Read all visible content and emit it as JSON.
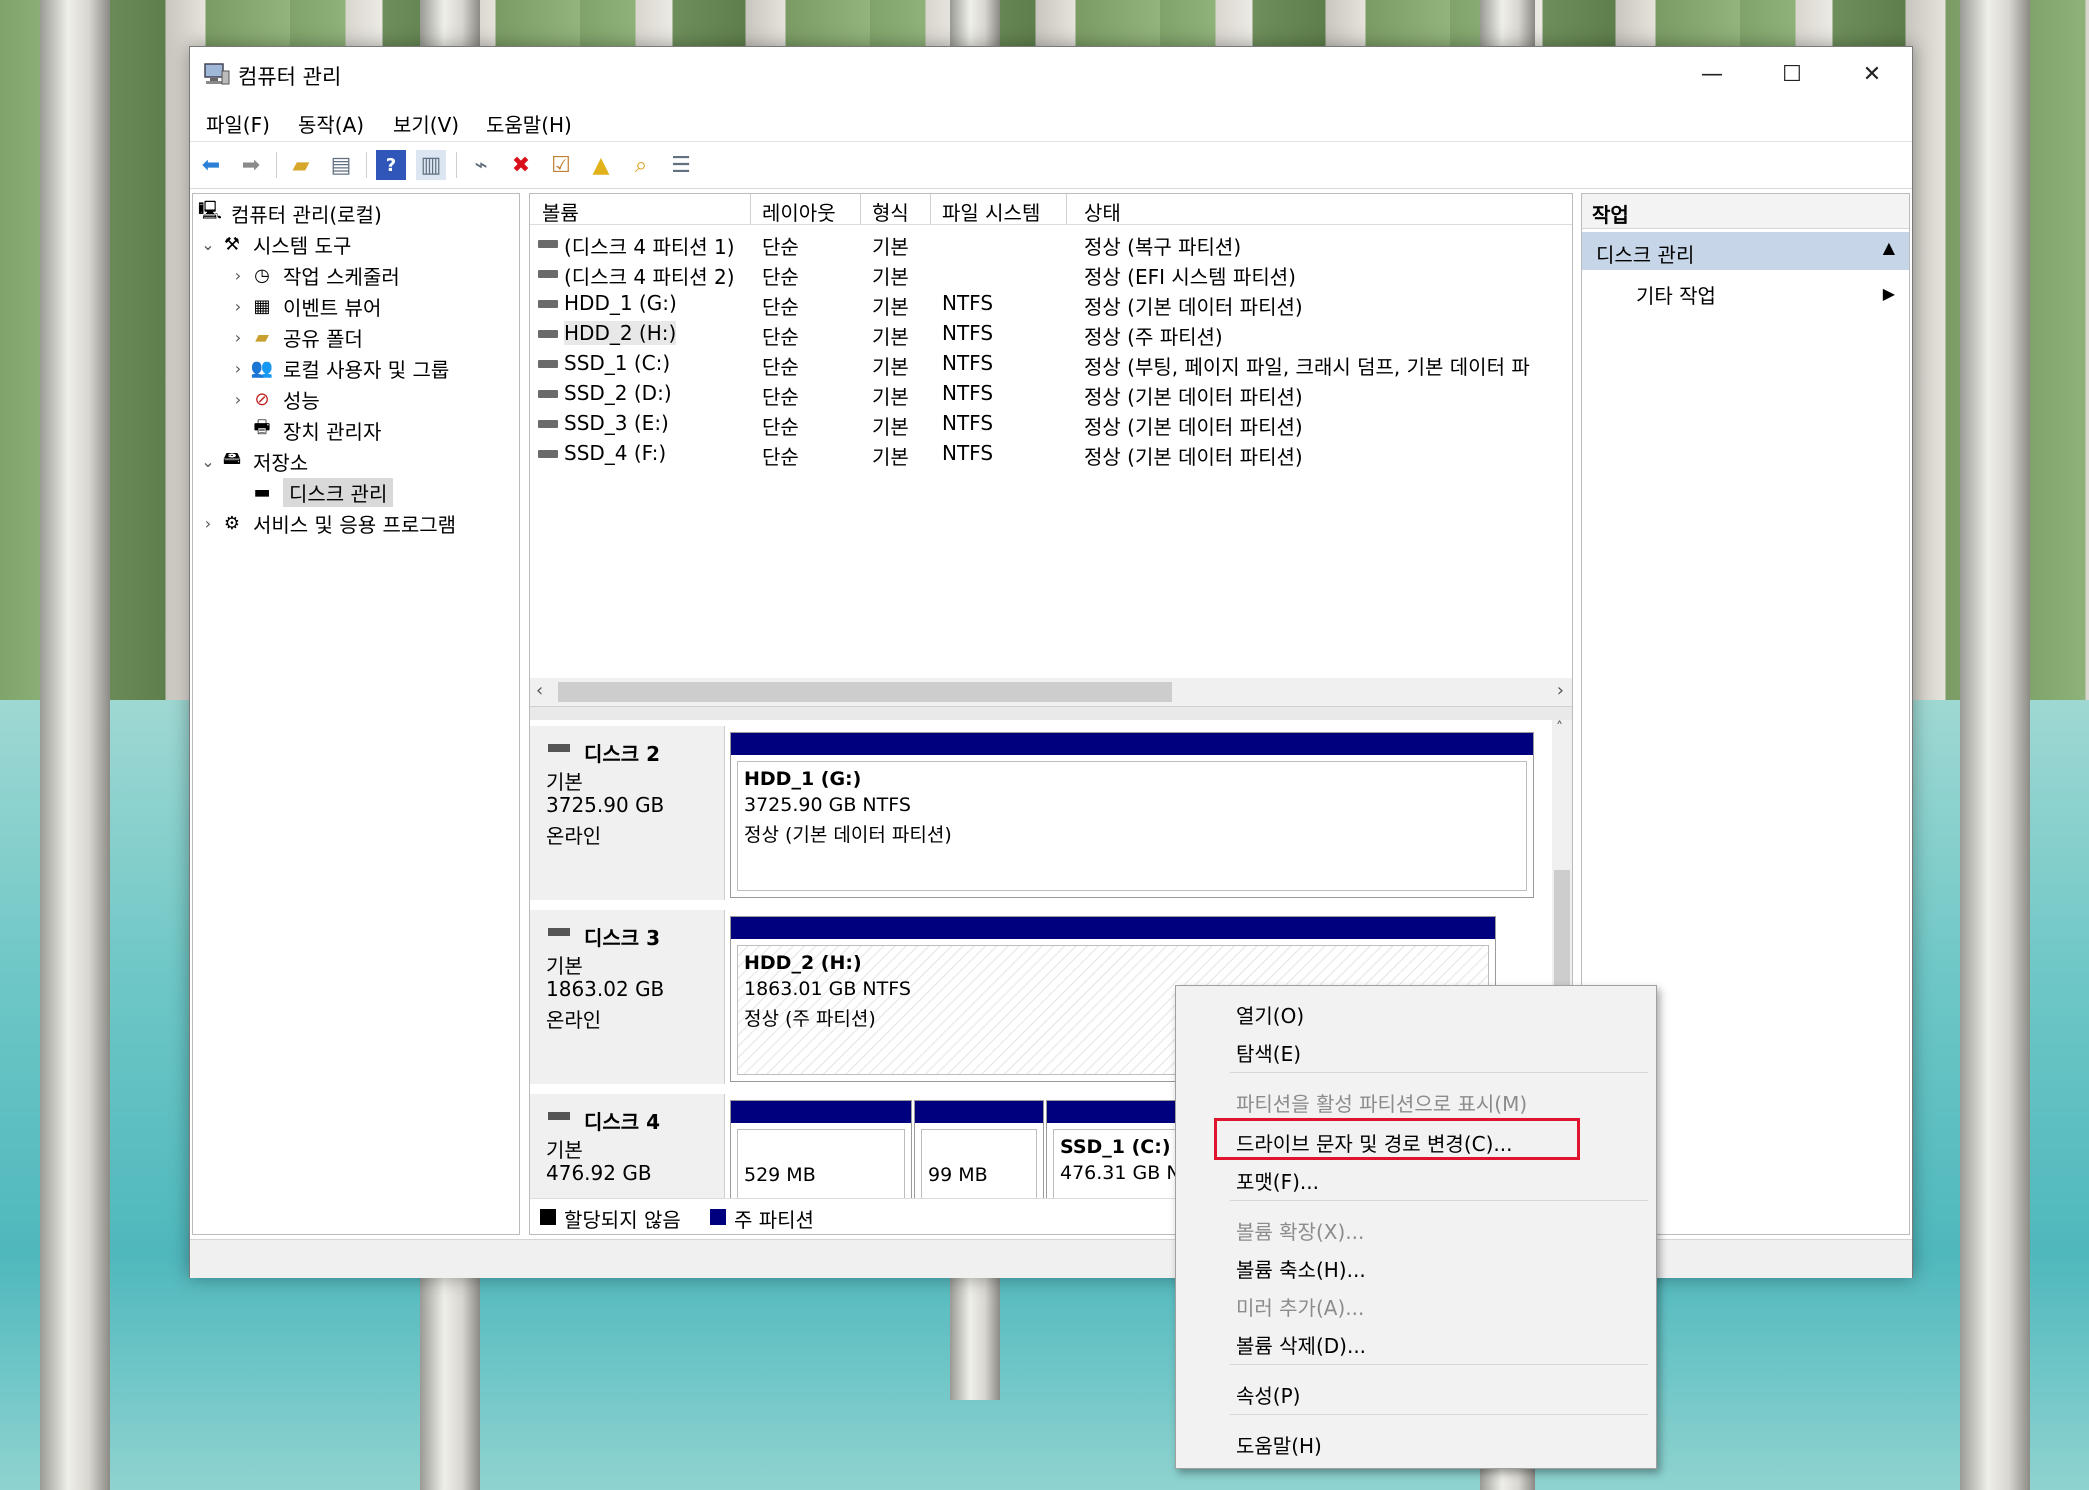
{
  "window": {
    "title": "컴퓨터 관리",
    "minimize": "—",
    "maximize": "☐",
    "close": "✕"
  },
  "menu": {
    "file": "파일(F)",
    "action": "동작(A)",
    "view": "보기(V)",
    "help": "도움말(H)"
  },
  "tree": {
    "root": "컴퓨터 관리(로컬)",
    "system_tools": "시스템 도구",
    "task_scheduler": "작업 스케줄러",
    "event_viewer": "이벤트 뷰어",
    "shared_folders": "공유 폴더",
    "local_users": "로컬 사용자 및 그룹",
    "performance": "성능",
    "device_manager": "장치 관리자",
    "storage": "저장소",
    "disk_management": "디스크 관리",
    "services_apps": "서비스 및 응용 프로그램"
  },
  "volumes": {
    "headers": {
      "volume": "볼륨",
      "layout": "레이아웃",
      "type": "형식",
      "fs": "파일 시스템",
      "status": "상태"
    },
    "rows": [
      {
        "name": "(디스크 4 파티션 1)",
        "layout": "단순",
        "type": "기본",
        "fs": "",
        "status": "정상 (복구 파티션)"
      },
      {
        "name": "(디스크 4 파티션 2)",
        "layout": "단순",
        "type": "기본",
        "fs": "",
        "status": "정상 (EFI 시스템 파티션)"
      },
      {
        "name": "HDD_1 (G:)",
        "layout": "단순",
        "type": "기본",
        "fs": "NTFS",
        "status": "정상 (기본 데이터 파티션)"
      },
      {
        "name": "HDD_2 (H:)",
        "layout": "단순",
        "type": "기본",
        "fs": "NTFS",
        "status": "정상 (주 파티션)"
      },
      {
        "name": "SSD_1 (C:)",
        "layout": "단순",
        "type": "기본",
        "fs": "NTFS",
        "status": "정상 (부팅, 페이지 파일, 크래시 덤프, 기본 데이터 파"
      },
      {
        "name": "SSD_2 (D:)",
        "layout": "단순",
        "type": "기본",
        "fs": "NTFS",
        "status": "정상 (기본 데이터 파티션)"
      },
      {
        "name": "SSD_3 (E:)",
        "layout": "단순",
        "type": "기본",
        "fs": "NTFS",
        "status": "정상 (기본 데이터 파티션)"
      },
      {
        "name": "SSD_4 (F:)",
        "layout": "단순",
        "type": "기본",
        "fs": "NTFS",
        "status": "정상 (기본 데이터 파티션)"
      }
    ]
  },
  "disks": {
    "disk2": {
      "name": "디스크 2",
      "type": "기본",
      "size": "3725.90 GB",
      "state": "온라인",
      "part": {
        "title": "HDD_1  (G:)",
        "size": "3725.90 GB NTFS",
        "status": "정상 (기본 데이터 파티션)"
      }
    },
    "disk3": {
      "name": "디스크 3",
      "type": "기본",
      "size": "1863.02 GB",
      "state": "온라인",
      "part": {
        "title": "HDD_2  (H:)",
        "size": "1863.01 GB NTFS",
        "status": "정상 (주 파티션)"
      }
    },
    "disk4": {
      "name": "디스크 4",
      "type": "기본",
      "size": "476.92 GB",
      "p1": "529 MB",
      "p2": "99 MB",
      "p3_title": "SSD_1  (C:)",
      "p3_size": "476.31 GB N"
    }
  },
  "legend": {
    "unallocated": "할당되지 않음",
    "primary": "주 파티션",
    "unallocated_color": "#000000",
    "primary_color": "#00007f"
  },
  "actions": {
    "header": "작업",
    "section": "디스크 관리",
    "more": "기타 작업"
  },
  "context_menu": {
    "open": "열기(O)",
    "explore": "탐색(E)",
    "mark_active": "파티션을 활성 파티션으로 표시(M)",
    "change_letter": "드라이브 문자 및 경로 변경(C)...",
    "format": "포맷(F)...",
    "extend": "볼륨 확장(X)...",
    "shrink": "볼륨 축소(H)...",
    "add_mirror": "미러 추가(A)...",
    "delete": "볼륨 삭제(D)...",
    "properties": "속성(P)",
    "help": "도움말(H)"
  },
  "accent": "#e0152d"
}
